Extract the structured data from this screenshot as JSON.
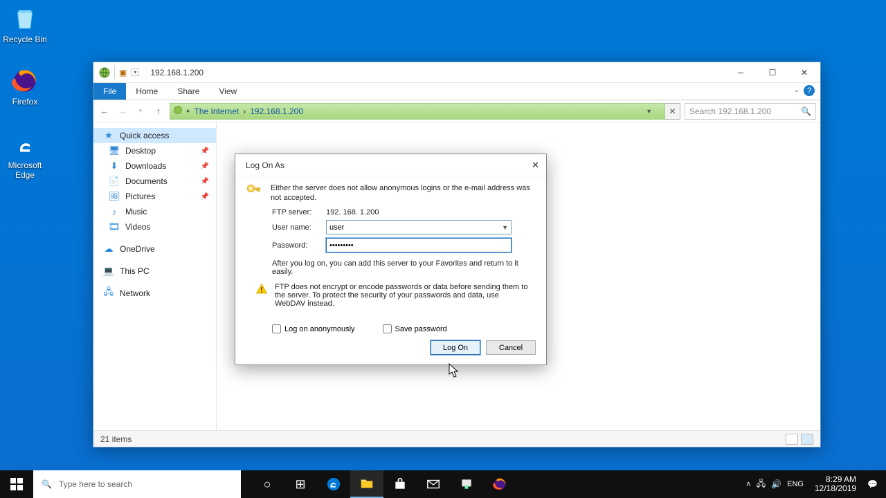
{
  "desktop_icons": {
    "recycle_bin": "Recycle Bin",
    "firefox": "Firefox",
    "edge": "Microsoft Edge"
  },
  "explorer": {
    "window_title": "192.168.1.200",
    "ribbon": {
      "file": "File",
      "home": "Home",
      "share": "Share",
      "view": "View"
    },
    "breadcrumb": {
      "root": "The Internet",
      "loc": "192.168.1.200"
    },
    "search_placeholder": "Search 192.168.1.200",
    "sidebar": {
      "quick_access": "Quick access",
      "desktop": "Desktop",
      "downloads": "Downloads",
      "documents": "Documents",
      "pictures": "Pictures",
      "music": "Music",
      "videos": "Videos",
      "onedrive": "OneDrive",
      "this_pc": "This PC",
      "network": "Network"
    },
    "status_items": "21 items"
  },
  "dialog": {
    "title": "Log On As",
    "message": "Either the server does not allow anonymous logins or the e-mail address was not accepted.",
    "ftp_label": "FTP server:",
    "ftp_value": "192. 168. 1.200",
    "user_label": "User name:",
    "user_value": "user",
    "pass_label": "Password:",
    "pass_value": "•••••••••",
    "favorite_note": "After you log on, you can add this server to your Favorites and return to it easily.",
    "warning": "FTP does not encrypt or encode passwords or data before sending them to the server.  To protect the security of your passwords and data, use WebDAV instead.",
    "anon_label": "Log on anonymously",
    "save_label": "Save password",
    "logon_btn": "Log On",
    "cancel_btn": "Cancel"
  },
  "taskbar": {
    "search_placeholder": "Type here to search",
    "time": "8:29 AM",
    "date": "12/18/2019"
  }
}
